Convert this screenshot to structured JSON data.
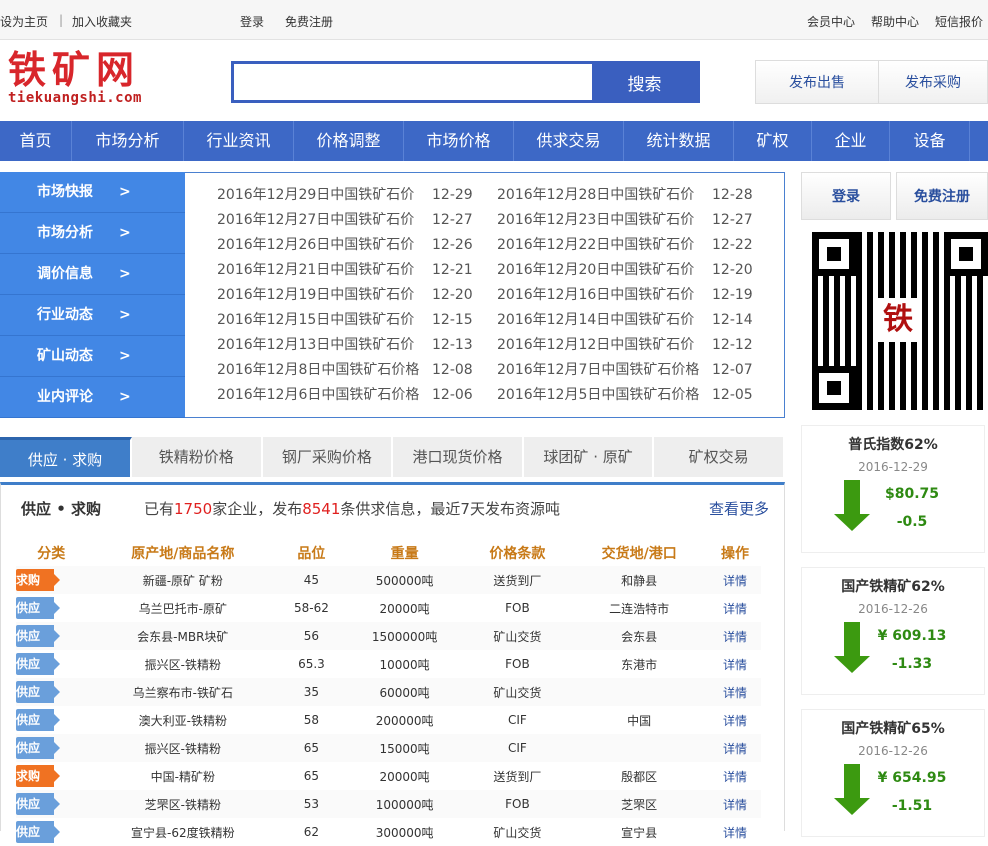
{
  "topbar": {
    "set_home": "设为主页",
    "sep": "|",
    "favorite": "加入收藏夹",
    "login": "登录",
    "register": "免费注册",
    "member": "会员中心",
    "help": "帮助中心",
    "sms": "短信报价"
  },
  "logo": {
    "cn": "铁矿网",
    "en": "tiekuangshi.com"
  },
  "search": {
    "value": "",
    "button": "搜索"
  },
  "publish": {
    "sell": "发布出售",
    "buy": "发布采购"
  },
  "nav": [
    "首页",
    "市场分析",
    "行业资讯",
    "价格调整",
    "市场价格",
    "供求交易",
    "统计数据",
    "矿权",
    "企业",
    "设备"
  ],
  "left_menu": [
    "市场快报",
    "市场分析",
    "调价信息",
    "行业动态",
    "矿山动态",
    "业内评论"
  ],
  "menu_arrow": ">",
  "news": [
    [
      {
        "t": "2016年12月29日中国铁矿石价",
        "d": "12-29"
      },
      {
        "t": "2016年12月28日中国铁矿石价",
        "d": "12-28"
      }
    ],
    [
      {
        "t": "2016年12月27日中国铁矿石价",
        "d": "12-27"
      },
      {
        "t": "2016年12月23日中国铁矿石价",
        "d": "12-27"
      }
    ],
    [
      {
        "t": "2016年12月26日中国铁矿石价",
        "d": "12-26"
      },
      {
        "t": "2016年12月22日中国铁矿石价",
        "d": "12-22"
      }
    ],
    [
      {
        "t": "2016年12月21日中国铁矿石价",
        "d": "12-21"
      },
      {
        "t": "2016年12月20日中国铁矿石价",
        "d": "12-20"
      }
    ],
    [
      {
        "t": "2016年12月19日中国铁矿石价",
        "d": "12-20"
      },
      {
        "t": "2016年12月16日中国铁矿石价",
        "d": "12-19"
      }
    ],
    [
      {
        "t": "2016年12月15日中国铁矿石价",
        "d": "12-15"
      },
      {
        "t": "2016年12月14日中国铁矿石价",
        "d": "12-14"
      }
    ],
    [
      {
        "t": "2016年12月13日中国铁矿石价",
        "d": "12-13"
      },
      {
        "t": "2016年12月12日中国铁矿石价",
        "d": "12-12"
      }
    ],
    [
      {
        "t": "2016年12月8日中国铁矿石价格",
        "d": "12-08"
      },
      {
        "t": "2016年12月7日中国铁矿石价格",
        "d": "12-07"
      }
    ],
    [
      {
        "t": "2016年12月6日中国铁矿石价格",
        "d": "12-06"
      },
      {
        "t": "2016年12月5日中国铁矿石价格",
        "d": "12-05"
      }
    ]
  ],
  "side": {
    "login": "登录",
    "register": "免费注册",
    "qr_char": "铁"
  },
  "tabs": [
    "供应 · 求购",
    "铁精粉价格",
    "钢厂采购价格",
    "港口现货价格",
    "球团矿 · 原矿",
    "矿权交易"
  ],
  "panel": {
    "title": "供应 • 求购",
    "info_a": "已有",
    "companies": "1750",
    "info_b": "家企业，发布",
    "posts": "8541",
    "info_c": "条供求信息，最近7天发布资源吨",
    "more": "查看更多"
  },
  "table": {
    "headers": [
      "分类",
      "原产地/商品名称",
      "品位",
      "重量",
      "价格条款",
      "交货地/港口",
      "操作"
    ],
    "rows": [
      [
        "求购",
        "新疆-原矿 矿粉",
        "45",
        "500000吨",
        "送货到厂",
        "和静县",
        "详情"
      ],
      [
        "供应",
        "乌兰巴托市-原矿",
        "58-62",
        "20000吨",
        "FOB",
        "二连浩特市",
        "详情"
      ],
      [
        "供应",
        "会东县-MBR块矿",
        "56",
        "1500000吨",
        "矿山交货",
        "会东县",
        "详情"
      ],
      [
        "供应",
        "振兴区-铁精粉",
        "65.3",
        "10000吨",
        "FOB",
        "东港市",
        "详情"
      ],
      [
        "供应",
        "乌兰察布市-铁矿石",
        "35",
        "60000吨",
        "矿山交货",
        "",
        "详情"
      ],
      [
        "供应",
        "澳大利亚-铁精粉",
        "58",
        "200000吨",
        "CIF",
        "中国",
        "详情"
      ],
      [
        "供应",
        "振兴区-铁精粉",
        "65",
        "15000吨",
        "CIF",
        "",
        "详情"
      ],
      [
        "求购",
        "中国-精矿粉",
        "65",
        "20000吨",
        "送货到厂",
        "殷都区",
        "详情"
      ],
      [
        "供应",
        "芝罘区-铁精粉",
        "53",
        "100000吨",
        "FOB",
        "芝罘区",
        "详情"
      ],
      [
        "供应",
        "宣宁县-62度铁精粉",
        "62",
        "300000吨",
        "矿山交货",
        "宣宁县",
        "详情"
      ]
    ]
  },
  "prices": [
    {
      "title": "普氏指数62%",
      "date": "2016-12-29",
      "price": "$80.75",
      "change": "-0.5"
    },
    {
      "title": "国产铁精矿62%",
      "date": "2016-12-26",
      "price": "¥ 609.13",
      "change": "-1.33"
    },
    {
      "title": "国产铁精矿65%",
      "date": "2016-12-26",
      "price": "¥ 654.95",
      "change": "-1.51"
    }
  ]
}
